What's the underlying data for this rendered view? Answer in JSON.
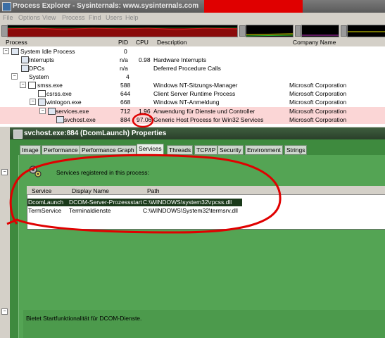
{
  "window": {
    "title": "Process Explorer - Sysinternals: www.sysinternals.com",
    "menu": [
      "File",
      "Options",
      "View",
      "Process",
      "Find",
      "Users",
      "Help"
    ],
    "colors": {
      "highlight": "#fbd6d6",
      "annotation": "#e00000"
    }
  },
  "tree": {
    "headers": {
      "process": "Process",
      "pid": "PID",
      "cpu": "CPU",
      "description": "Description",
      "company": "Company Name"
    },
    "rows": [
      {
        "name": "System Idle Process",
        "pid": "0",
        "cpu": "",
        "desc": "",
        "company": ""
      },
      {
        "name": "Interrupts",
        "pid": "n/a",
        "cpu": "0.98",
        "desc": "Hardware Interrupts",
        "company": ""
      },
      {
        "name": "DPCs",
        "pid": "n/a",
        "cpu": "",
        "desc": "Deferred Procedure Calls",
        "company": ""
      },
      {
        "name": "System",
        "pid": "4",
        "cpu": "",
        "desc": "",
        "company": ""
      },
      {
        "name": "smss.exe",
        "pid": "588",
        "cpu": "",
        "desc": "Windows NT-Sitzungs-Manager",
        "company": "Microsoft Corporation"
      },
      {
        "name": "csrss.exe",
        "pid": "644",
        "cpu": "",
        "desc": "Client Server Runtime Process",
        "company": "Microsoft Corporation"
      },
      {
        "name": "winlogon.exe",
        "pid": "668",
        "cpu": "",
        "desc": "Windows NT-Anmeldung",
        "company": "Microsoft Corporation"
      },
      {
        "name": "services.exe",
        "pid": "712",
        "cpu": "1.96",
        "desc": "Anwendung für Dienste und Controller",
        "company": "Microsoft Corporation"
      },
      {
        "name": "svchost.exe",
        "pid": "884",
        "cpu": "97.06",
        "desc": "Generic Host Process for Win32 Services",
        "company": "Microsoft Corporation"
      }
    ]
  },
  "dialog": {
    "title": "svchost.exe:884 (DcomLaunch) Properties",
    "tabs": [
      "Image",
      "Performance",
      "Performance Graph",
      "Services",
      "Threads",
      "TCP/IP",
      "Security",
      "Environment",
      "Strings"
    ],
    "active_tab": "Services",
    "services_label": "Services registered in this process:",
    "columns": {
      "service": "Service",
      "display": "Display Name",
      "path": "Path"
    },
    "services": [
      {
        "service": "DcomLaunch",
        "display": "DCOM-Server-Prozessstart",
        "path": "C:\\WINDOWS\\system32\\rpcss.dll"
      },
      {
        "service": "TermService",
        "display": "Terminaldienste",
        "path": "C:\\WINDOWS\\System32\\termsrv.dll"
      }
    ],
    "description": "Bietet Startfunktionalität für DCOM-Dienste."
  }
}
